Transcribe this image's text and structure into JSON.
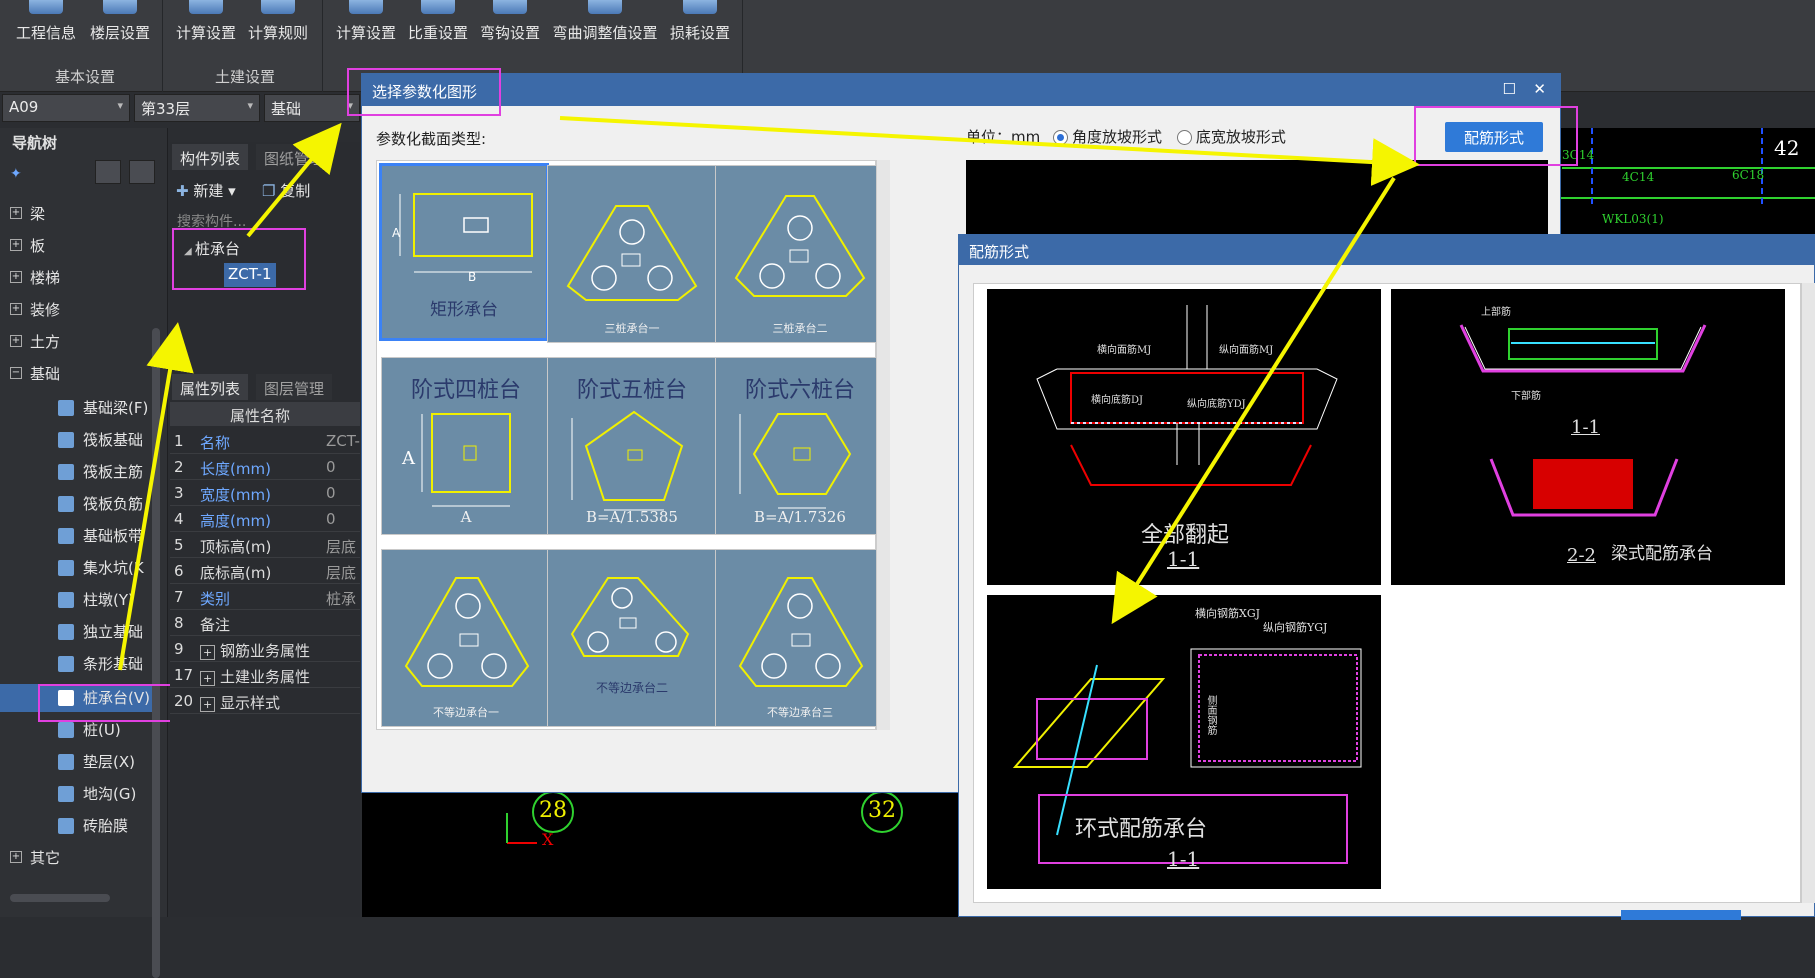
{
  "ribbon": {
    "buttons": [
      "工程信息",
      "楼层设置",
      "计算设置",
      "计算规则",
      "计算设置",
      "比重设置",
      "弯钩设置",
      "弯曲调整值设置",
      "损耗设置"
    ],
    "groups": [
      "基本设置",
      "土建设置"
    ]
  },
  "filters": {
    "floor_code": "A09",
    "floor": "第33层",
    "category": "基础"
  },
  "nav": {
    "title": "导航树",
    "items": [
      {
        "label": "梁",
        "box": "+"
      },
      {
        "label": "板",
        "box": "+"
      },
      {
        "label": "楼梯",
        "box": "+"
      },
      {
        "label": "装修",
        "box": "+"
      },
      {
        "label": "土方",
        "box": "+"
      },
      {
        "label": "基础",
        "box": "−"
      }
    ],
    "sub_items": [
      "基础梁(F)",
      "筏板基础",
      "筏板主筋",
      "筏板负筋",
      "基础板带",
      "集水坑(K",
      "柱墩(Y)",
      "独立基础",
      "条形基础",
      "桩承台(V)",
      "桩(U)",
      "垫层(X)",
      "地沟(G)",
      "砖胎膜"
    ],
    "other": {
      "label": "其它",
      "box": "+"
    }
  },
  "component_panel": {
    "tabs": [
      "构件列表",
      "图纸管理"
    ],
    "toolbar": {
      "new": "新建",
      "copy": "复制"
    },
    "search_placeholder": "搜索构件...",
    "tree_root": "桩承台",
    "tree_child": "ZCT-1"
  },
  "property_panel": {
    "tabs": [
      "属性列表",
      "图层管理"
    ],
    "header": "属性名称",
    "rows": [
      {
        "n": "1",
        "k": "名称",
        "v": "ZCT-"
      },
      {
        "n": "2",
        "k": "长度(mm)",
        "v": "0"
      },
      {
        "n": "3",
        "k": "宽度(mm)",
        "v": "0"
      },
      {
        "n": "4",
        "k": "高度(mm)",
        "v": "0"
      },
      {
        "n": "5",
        "k": "顶标高(m)",
        "v": "层底"
      },
      {
        "n": "6",
        "k": "底标高(m)",
        "v": "层底"
      },
      {
        "n": "7",
        "k": "类别",
        "v": "桩承"
      },
      {
        "n": "8",
        "k": "备注",
        "v": ""
      },
      {
        "n": "9",
        "k": "钢筋业务属性",
        "v": ""
      },
      {
        "n": "17",
        "k": "土建业务属性",
        "v": ""
      },
      {
        "n": "20",
        "k": "显示样式",
        "v": ""
      }
    ],
    "expand": "+"
  },
  "dialog1": {
    "title": "选择参数化图形",
    "section_label": "参数化截面类型:",
    "unit_label": "单位：mm",
    "radio1": "角度放坡形式",
    "radio2": "底宽放坡形式",
    "button": "配筋形式",
    "dim_a": "A",
    "dim_b": "B",
    "thumbs": {
      "t1": "矩形承台",
      "t2": "三桩承台一",
      "t3": "三桩承台二",
      "t4": "阶式四桩台",
      "t5": "阶式五桩台",
      "t6": "阶式六桩台",
      "t5b": "B=A/1.5385",
      "t6b": "B=A/1.7326",
      "t7": "不等边承台一",
      "t8": "不等边承台二",
      "t9": "不等边承台三"
    }
  },
  "dialog2": {
    "title": "配筋形式",
    "p1": {
      "title": "全部翻起",
      "section": "1-1",
      "l1": "横向面筋MJ",
      "l2": "纵向面筋MJ",
      "l3": "横向底筋DJ",
      "l4": "纵向底筋YDJ"
    },
    "p2": {
      "title": "梁式配筋承台",
      "section1": "1-1",
      "section2": "2-2",
      "l1": "上部筋",
      "l2": "下部筋"
    },
    "p3": {
      "title": "环式配筋承台",
      "section": "1-1",
      "l1": "横向钢筋XGJ",
      "l2": "纵向钢筋YGJ",
      "l3": "侧面钢筋"
    }
  },
  "canvas": {
    "axis1": "28",
    "axis2": "32",
    "axis3": "42",
    "axis_x": "X",
    "tag1": "4C14",
    "tag2": "WKL03(1)",
    "tag3": "3C14",
    "tag4": "6C18"
  },
  "colors": {
    "accent": "#2f7ad8",
    "highlight": "#e040e0",
    "arrow": "#f5f500"
  }
}
